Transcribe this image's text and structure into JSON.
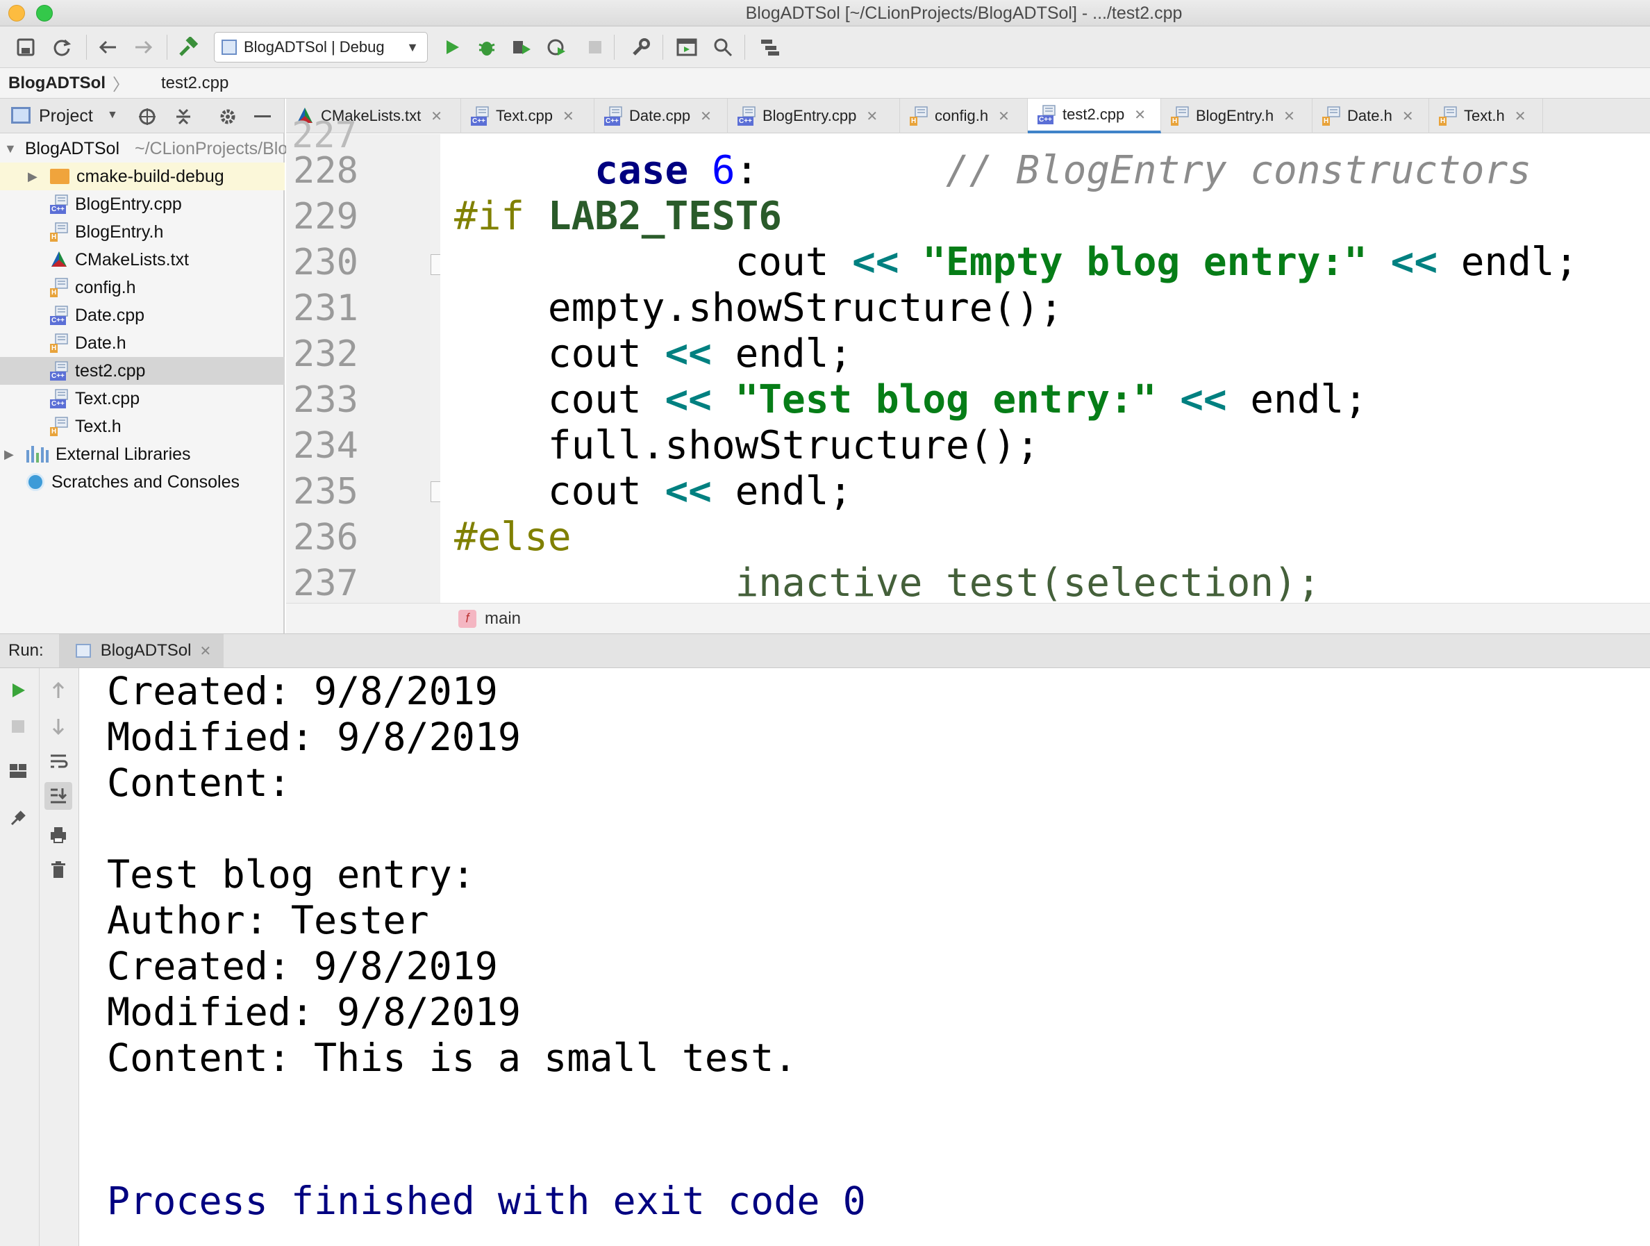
{
  "window": {
    "title": "BlogADTSol [~/CLionProjects/BlogADTSol] - .../test2.cpp"
  },
  "toolbar": {
    "run_config": "BlogADTSol | Debug"
  },
  "navbar": {
    "project": "BlogADTSol",
    "file": "test2.cpp"
  },
  "project_panel": {
    "title": "Project",
    "root": {
      "name": "BlogADTSol",
      "path": "~/CLionProjects/BlogADTSol"
    },
    "items": [
      {
        "label": "cmake-build-debug",
        "type": "folder"
      },
      {
        "label": "BlogEntry.cpp",
        "type": "cpp"
      },
      {
        "label": "BlogEntry.h",
        "type": "h"
      },
      {
        "label": "CMakeLists.txt",
        "type": "cmake"
      },
      {
        "label": "config.h",
        "type": "h"
      },
      {
        "label": "Date.cpp",
        "type": "cpp"
      },
      {
        "label": "Date.h",
        "type": "h"
      },
      {
        "label": "test2.cpp",
        "type": "cpp"
      },
      {
        "label": "Text.cpp",
        "type": "cpp"
      },
      {
        "label": "Text.h",
        "type": "h"
      }
    ],
    "external_libraries": "External Libraries",
    "scratches": "Scratches and Consoles"
  },
  "tabs": [
    {
      "label": "CMakeLists.txt",
      "type": "cmake"
    },
    {
      "label": "Text.cpp",
      "type": "cpp"
    },
    {
      "label": "Date.cpp",
      "type": "cpp"
    },
    {
      "label": "BlogEntry.cpp",
      "type": "cpp"
    },
    {
      "label": "config.h",
      "type": "h"
    },
    {
      "label": "test2.cpp",
      "type": "cpp",
      "active": true
    },
    {
      "label": "BlogEntry.h",
      "type": "h"
    },
    {
      "label": "Date.h",
      "type": "h"
    },
    {
      "label": "Text.h",
      "type": "h"
    }
  ],
  "editor": {
    "lines": [
      {
        "num": "228",
        "indent": "      ",
        "kw": "case",
        "num_lit": "6",
        "rest": ":",
        "comment": "// BlogEntry constructors"
      },
      {
        "num": "229",
        "pp": "#if",
        "macro": "LAB2_TEST6"
      },
      {
        "num": "230",
        "indent": "            ",
        "c1": "cout ",
        "op1": "<<",
        "str": "\"Empty blog entry:\"",
        "op2": "<<",
        "c2": " endl;"
      },
      {
        "num": "231",
        "indent": "    ",
        "c1": "empty.showStructure();"
      },
      {
        "num": "232",
        "indent": "    ",
        "c1": "cout ",
        "op1": "<<",
        "c2": " endl;"
      },
      {
        "num": "233",
        "indent": "    ",
        "c1": "cout ",
        "op1": "<<",
        "str": "\"Test blog entry:\"",
        "op2": "<<",
        "c2": " endl;"
      },
      {
        "num": "234",
        "indent": "    ",
        "c1": "full.showStructure();"
      },
      {
        "num": "235",
        "indent": "    ",
        "c1": "cout ",
        "op1": "<<",
        "c2": " endl;"
      },
      {
        "num": "236",
        "pp": "#else"
      },
      {
        "num": "237",
        "indent": "            ",
        "inactive": "inactive_test(selection);"
      }
    ],
    "breadcrumb": {
      "badge": "f",
      "label": "main"
    }
  },
  "run": {
    "label": "Run:",
    "tab": "BlogADTSol",
    "output": [
      "Created: 9/8/2019",
      "Modified: 9/8/2019",
      "Content:",
      "",
      "Test blog entry:",
      "Author: Tester",
      "Created: 9/8/2019",
      "Modified: 9/8/2019",
      "Content: This is a small test.",
      "",
      ""
    ],
    "exit_message": "Process finished with exit code 0"
  },
  "colors": {
    "keyword": "#000080",
    "number": "#0000ff",
    "string": "#067d17",
    "operator": "#008080",
    "preprocessor": "#808000",
    "macro": "#2a5b2a",
    "comment": "#8c8c8c",
    "inactive": "#44603a",
    "exit": "#000080"
  }
}
